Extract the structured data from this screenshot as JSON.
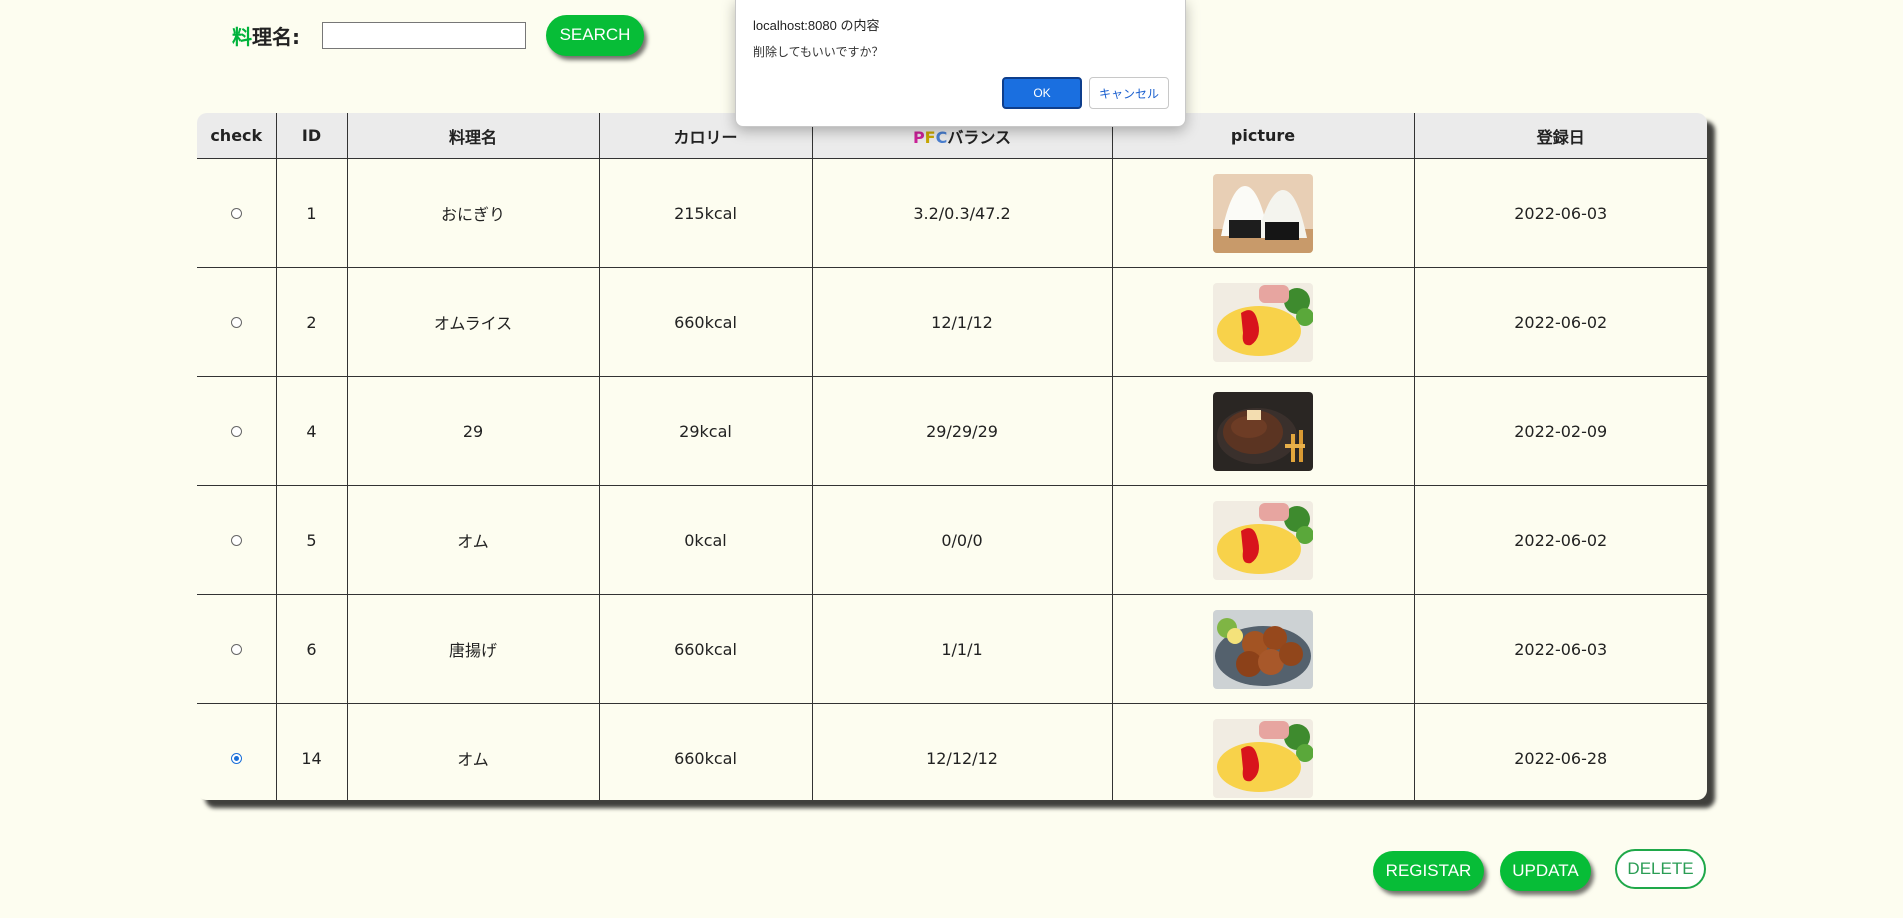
{
  "search": {
    "label_accent": "料",
    "label_rest": "理名:",
    "input_value": "",
    "button_label": "SEARCH"
  },
  "table": {
    "headers": {
      "check": "check",
      "id": "ID",
      "name": "料理名",
      "calorie": "カロリー",
      "pfc_p": "P",
      "pfc_f": "F",
      "pfc_c": "C",
      "pfc_rest": "バランス",
      "picture": "picture",
      "date": "登録日"
    },
    "rows": [
      {
        "checked": false,
        "id": "1",
        "name": "おにぎり",
        "calorie": "215kcal",
        "pfc": "3.2/0.3/47.2",
        "image": "onigiri-photo",
        "date": "2022-06-03"
      },
      {
        "checked": false,
        "id": "2",
        "name": "オムライス",
        "calorie": "660kcal",
        "pfc": "12/1/12",
        "image": "omurice-photo",
        "date": "2022-06-02"
      },
      {
        "checked": false,
        "id": "4",
        "name": "29",
        "calorie": "29kcal",
        "pfc": "29/29/29",
        "image": "steak-photo",
        "date": "2022-02-09"
      },
      {
        "checked": false,
        "id": "5",
        "name": "オム",
        "calorie": "0kcal",
        "pfc": "0/0/0",
        "image": "omurice-photo",
        "date": "2022-06-02"
      },
      {
        "checked": false,
        "id": "6",
        "name": "唐揚げ",
        "calorie": "660kcal",
        "pfc": "1/1/1",
        "image": "karaage-photo",
        "date": "2022-06-03"
      },
      {
        "checked": true,
        "id": "14",
        "name": "オム",
        "calorie": "660kcal",
        "pfc": "12/12/12",
        "image": "omurice-photo",
        "date": "2022-06-28"
      }
    ]
  },
  "actions": {
    "registar_label": "REGISTAR",
    "updata_label": "UPDATA",
    "delete_label": "DELETE"
  },
  "dialog": {
    "title": "localhost:8080 の内容",
    "message": "削除してもいいですか？",
    "ok_label": "OK",
    "cancel_label": "キャンセル"
  },
  "colors": {
    "accent_green": "#07bd37",
    "background": "#fdfdf0",
    "dialog_blue": "#1a6fe0"
  }
}
